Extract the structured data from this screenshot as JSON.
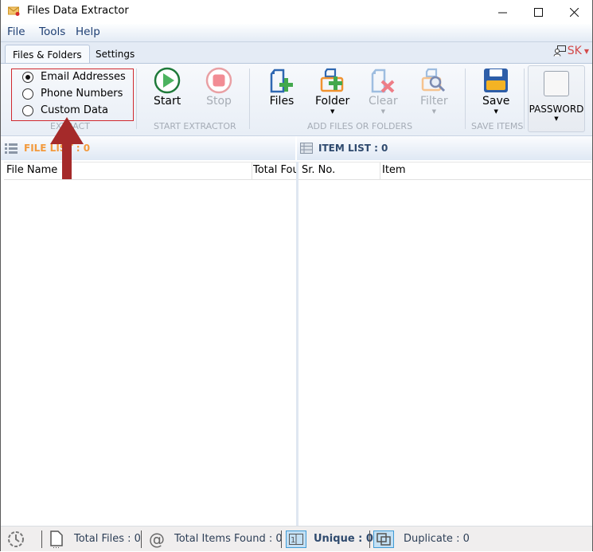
{
  "window": {
    "title": "Files Data Extractor",
    "controls": {
      "minimize": "minimize-icon",
      "maximize": "maximize-icon",
      "close": "close-icon"
    }
  },
  "menu": [
    "File",
    "Tools",
    "Help"
  ],
  "tabs": [
    {
      "label": "Files & Folders",
      "active": true
    },
    {
      "label": "Settings",
      "active": false
    }
  ],
  "user": {
    "initials": "SK",
    "icon": "user-account-icon"
  },
  "ribbon": {
    "extract": {
      "group_label": "EXTRACT",
      "options": [
        {
          "label": "Email Addresses",
          "selected": true
        },
        {
          "label": "Phone Numbers",
          "selected": false
        },
        {
          "label": "Custom Data",
          "selected": false
        }
      ]
    },
    "start_extractor": {
      "group_label": "START EXTRACTOR",
      "start_label": "Start",
      "stop_label": "Stop",
      "stop_enabled": false
    },
    "add_files": {
      "group_label": "ADD FILES OR FOLDERS",
      "files_label": "Files",
      "folder_label": "Folder",
      "clear_label": "Clear",
      "filter_label": "Filter",
      "clear_enabled": false,
      "filter_enabled": false
    },
    "save_items": {
      "group_label": "SAVE ITEMS",
      "save_label": "Save"
    },
    "password": {
      "label": "PASSWORD"
    }
  },
  "file_list": {
    "title": "FILE LIST : 0",
    "title_color": "#f39a3d",
    "columns": [
      "File Name",
      "Total Fou"
    ],
    "rows": []
  },
  "item_list": {
    "title": "ITEM LIST : 0",
    "title_color": "#2f4a6e",
    "columns": [
      "Sr. No.",
      "Item"
    ],
    "rows": []
  },
  "status": {
    "total_files": "Total Files : 0",
    "total_items": "Total Items Found : 0",
    "unique": "Unique : 0",
    "duplicate": "Duplicate : 0"
  },
  "annotation": {
    "color": "#a52a2a",
    "shape": "arrow-up",
    "highlight_color": "#d0282e"
  }
}
